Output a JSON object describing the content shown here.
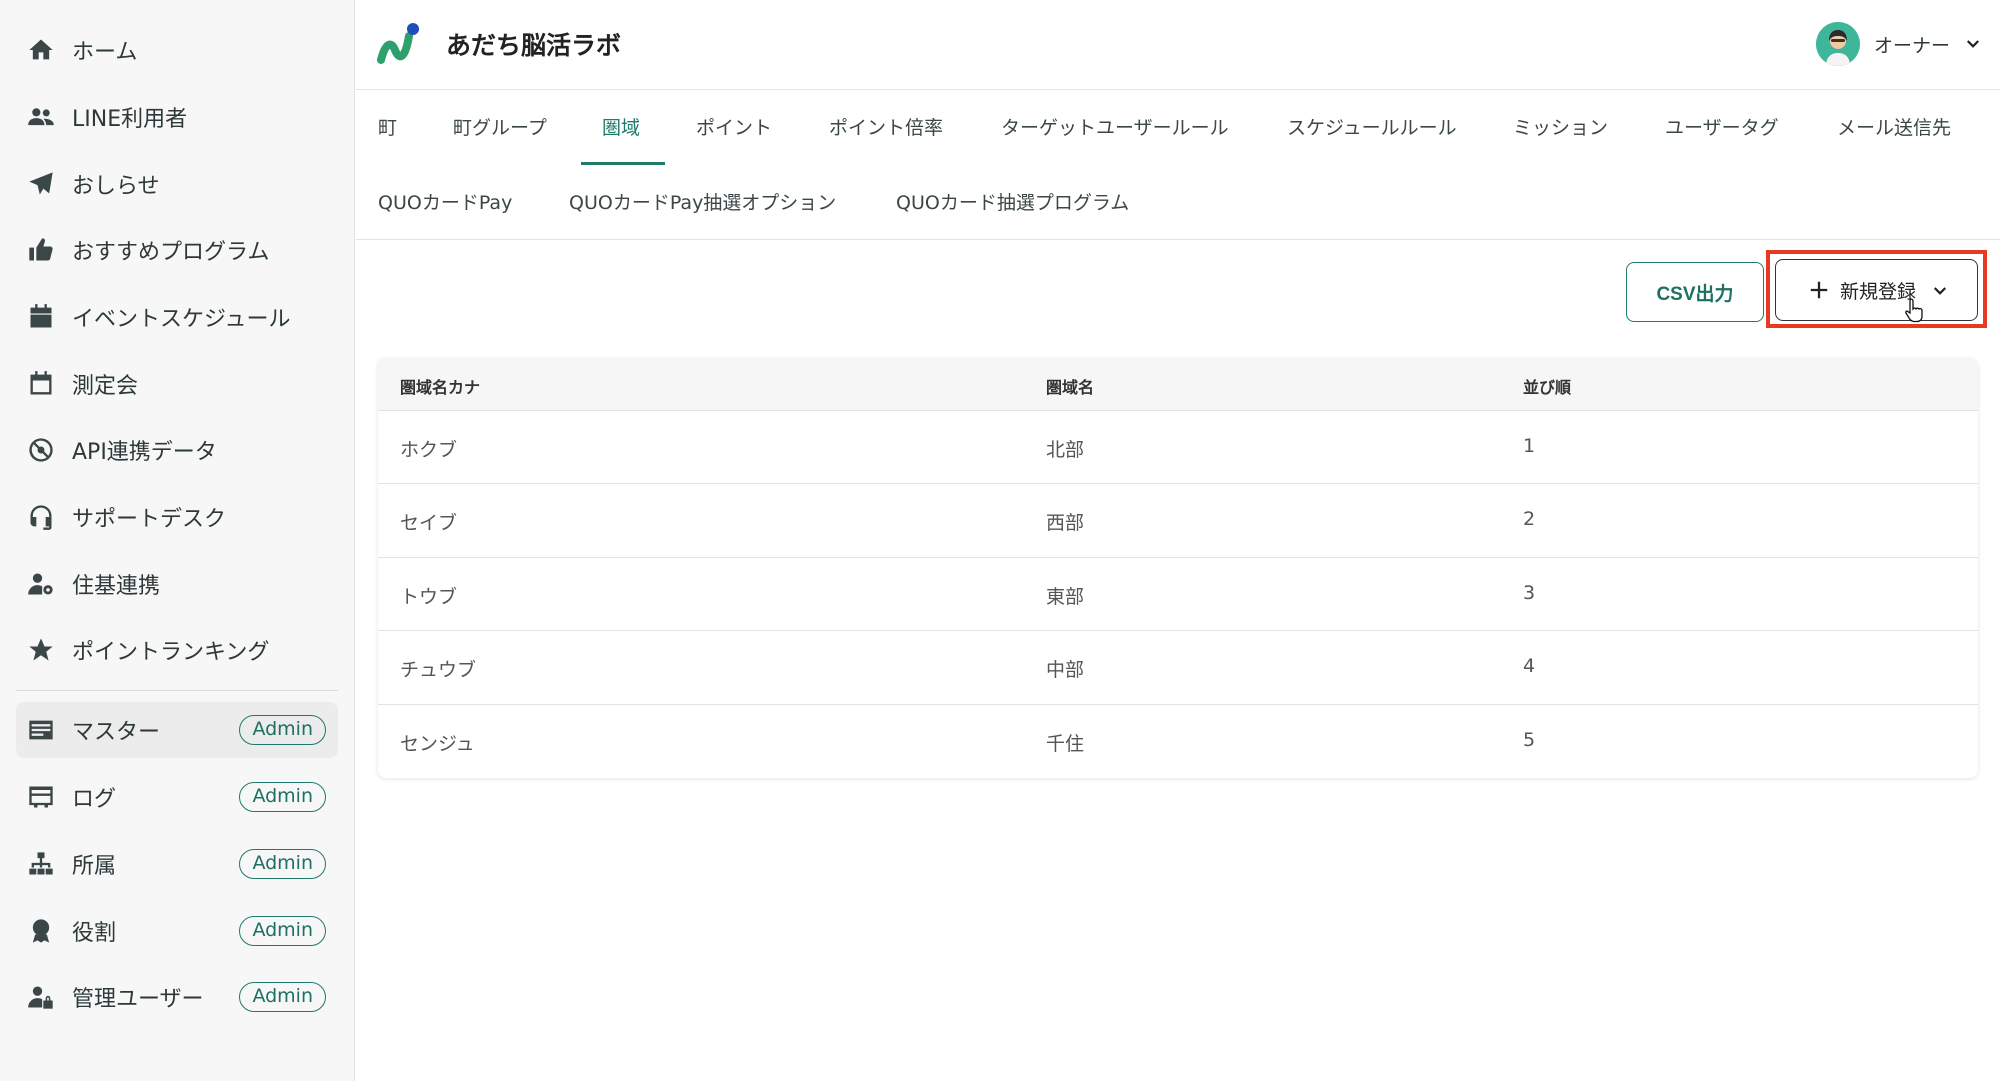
{
  "sidebar": {
    "items": [
      {
        "label": "ホーム",
        "icon": "home-icon"
      },
      {
        "label": "LINE利用者",
        "icon": "users-icon"
      },
      {
        "label": "おしらせ",
        "icon": "paper-plane-icon"
      },
      {
        "label": "おすすめプログラム",
        "icon": "thumbs-up-icon"
      },
      {
        "label": "イベントスケジュール",
        "icon": "calendar-icon"
      },
      {
        "label": "測定会",
        "icon": "calendar-blank-icon"
      },
      {
        "label": "API連携データ",
        "icon": "api-icon"
      },
      {
        "label": "サポートデスク",
        "icon": "headset-icon"
      },
      {
        "label": "住基連携",
        "icon": "user-gear-icon"
      },
      {
        "label": "ポイントランキング",
        "icon": "star-icon"
      }
    ],
    "admin_items": [
      {
        "label": "マスター",
        "badge": "Admin",
        "icon": "master-icon"
      },
      {
        "label": "ログ",
        "badge": "Admin",
        "icon": "log-icon"
      },
      {
        "label": "所属",
        "badge": "Admin",
        "icon": "org-icon"
      },
      {
        "label": "役割",
        "badge": "Admin",
        "icon": "award-icon"
      },
      {
        "label": "管理ユーザー",
        "badge": "Admin",
        "icon": "user-lock-icon"
      }
    ]
  },
  "header": {
    "title": "あだち脳活ラボ",
    "user_name": "オーナー"
  },
  "tabs": {
    "row1": [
      "町",
      "町グループ",
      "圏域",
      "ポイント",
      "ポイント倍率",
      "ターゲットユーザールール",
      "スケジュールルール",
      "ミッション",
      "ユーザータグ",
      "メール送信先"
    ],
    "row2": [
      "QUOカードPay",
      "QUOカードPay抽選オプション",
      "QUOカード抽選プログラム"
    ],
    "active": "圏域"
  },
  "toolbar": {
    "csv_label": "CSV出力",
    "new_label": "新規登録"
  },
  "table": {
    "columns": [
      "圏域名カナ",
      "圏域名",
      "並び順"
    ],
    "rows": [
      [
        "ホクブ",
        "北部",
        "1"
      ],
      [
        "セイブ",
        "西部",
        "2"
      ],
      [
        "トウブ",
        "東部",
        "3"
      ],
      [
        "チュウブ",
        "中部",
        "4"
      ],
      [
        "センジュ",
        "千住",
        "5"
      ]
    ]
  },
  "colors": {
    "accent": "#1f7a6c",
    "highlight": "#e63a22"
  }
}
